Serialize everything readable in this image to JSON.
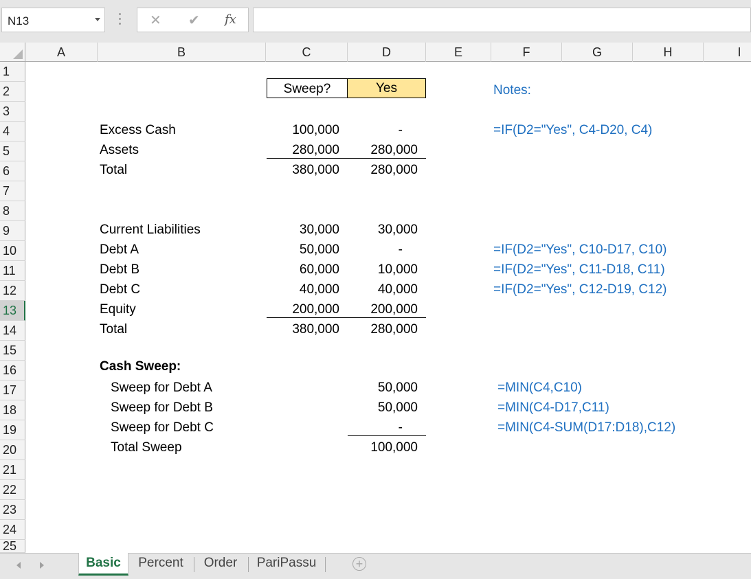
{
  "formula_bar": {
    "name_box": "N13",
    "cancel_glyph": "✕",
    "enter_glyph": "✔",
    "fx_label": "fx",
    "formula": ""
  },
  "columns": [
    "A",
    "B",
    "C",
    "D",
    "E",
    "F",
    "G",
    "H",
    "I"
  ],
  "rows": [
    "1",
    "2",
    "3",
    "4",
    "5",
    "6",
    "7",
    "8",
    "9",
    "10",
    "11",
    "12",
    "13",
    "14",
    "15",
    "16",
    "17",
    "18",
    "19",
    "20",
    "21",
    "22",
    "23",
    "24",
    "25"
  ],
  "active_row": "13",
  "sweep_toggle": {
    "label": "Sweep?",
    "value": "Yes"
  },
  "notes_title": "Notes:",
  "balance": {
    "excess_cash": {
      "label": "Excess Cash",
      "c": "100,000",
      "d": "-",
      "note": "=IF(D2=\"Yes\", C4-D20, C4)"
    },
    "assets": {
      "label": "Assets",
      "c": "280,000",
      "d": "280,000"
    },
    "total_assets": {
      "label": "Total",
      "c": "380,000",
      "d": "280,000"
    },
    "current_liabilities": {
      "label": "Current Liabilities",
      "c": "30,000",
      "d": "30,000"
    },
    "debt_a": {
      "label": "Debt A",
      "c": "50,000",
      "d": "-",
      "note": "=IF(D2=\"Yes\", C10-D17, C10)"
    },
    "debt_b": {
      "label": "Debt B",
      "c": "60,000",
      "d": "10,000",
      "note": "=IF(D2=\"Yes\", C11-D18, C11)"
    },
    "debt_c": {
      "label": "Debt C",
      "c": "40,000",
      "d": "40,000",
      "note": "=IF(D2=\"Yes\", C12-D19, C12)"
    },
    "equity": {
      "label": "Equity",
      "c": "200,000",
      "d": "200,000"
    },
    "total_liab": {
      "label": "Total",
      "c": "380,000",
      "d": "280,000"
    }
  },
  "cash_sweep": {
    "title": "Cash Sweep:",
    "sweep_a": {
      "label": "Sweep for Debt A",
      "d": "50,000",
      "note": "=MIN(C4,C10)"
    },
    "sweep_b": {
      "label": "Sweep for Debt B",
      "d": "50,000",
      "note": "=MIN(C4-D17,C11)"
    },
    "sweep_c": {
      "label": "Sweep for Debt C",
      "d": "-",
      "note": "=MIN(C4-SUM(D17:D18),C12)"
    },
    "total": {
      "label": "Total Sweep",
      "d": "100,000"
    }
  },
  "tabs": [
    "Basic",
    "Percent",
    "Order",
    "PariPassu"
  ],
  "add_sheet_glyph": "+"
}
